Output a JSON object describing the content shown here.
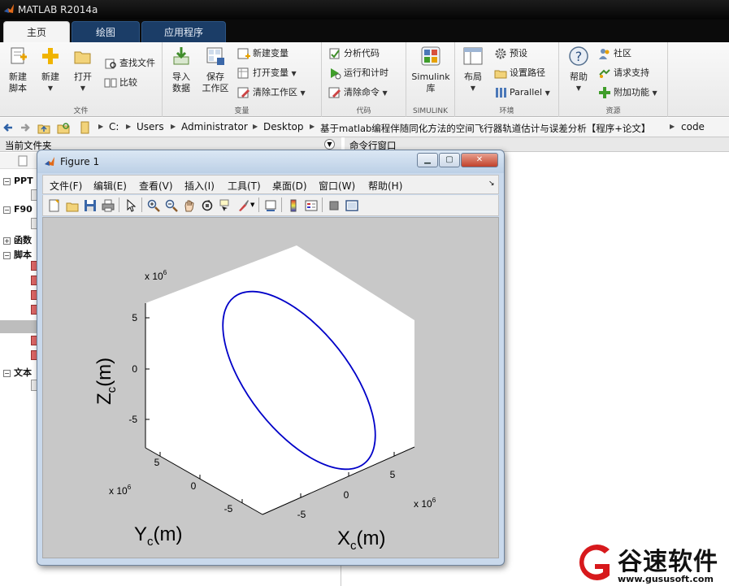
{
  "window": {
    "title": "MATLAB R2014a"
  },
  "tabs": [
    {
      "label": "主页",
      "active": true
    },
    {
      "label": "绘图",
      "active": false
    },
    {
      "label": "应用程序",
      "active": false
    }
  ],
  "toolstrip": {
    "file_group": {
      "label": "文件",
      "new_script": "新建\n脚本",
      "new": "新建",
      "open": "打开",
      "find_files": "查找文件",
      "compare": "比较"
    },
    "variable_group": {
      "label": "变量",
      "import_data": "导入\n数据",
      "save_workspace": "保存\n工作区",
      "new_variable": "新建变量",
      "open_variable": "打开变量",
      "clear_workspace": "清除工作区"
    },
    "code_group": {
      "label": "代码",
      "analyze_code": "分析代码",
      "run_and_time": "运行和计时",
      "clear_commands": "清除命令"
    },
    "simulink_group": {
      "label": "SIMULINK",
      "simulink_library": "Simulink\n库"
    },
    "environment_group": {
      "label": "环境",
      "layout": "布局",
      "preferences": "预设",
      "set_path": "设置路径",
      "parallel": "Parallel"
    },
    "resources_group": {
      "label": "资源",
      "help": "帮助",
      "community": "社区",
      "request_support": "请求支持",
      "add_ons": "附加功能"
    }
  },
  "address": {
    "crumbs": [
      "C:",
      "Users",
      "Administrator",
      "Desktop",
      "基于matlab编程伴随同化方法的空间飞行器轨道估计与误差分析【程序+论文】",
      "code"
    ]
  },
  "left_panel": {
    "title": "当前文件夹",
    "tree": [
      "PPT",
      "F90",
      "函数",
      "脚本",
      "文本"
    ]
  },
  "command_window": {
    "title": "命令行窗口"
  },
  "figure": {
    "title": "Figure 1",
    "menus": [
      "文件(F)",
      "编辑(E)",
      "查看(V)",
      "插入(I)",
      "工具(T)",
      "桌面(D)",
      "窗口(W)",
      "帮助(H)"
    ],
    "toolbar_icons": [
      "new-figure-icon",
      "open-file-icon",
      "save-icon",
      "print-icon",
      "pointer-icon",
      "zoom-in-icon",
      "zoom-out-icon",
      "pan-icon",
      "rotate-icon",
      "data-cursor-icon",
      "brush-icon",
      "link-plot-icon",
      "colorbar-icon",
      "legend-icon",
      "hide-plot-tools-icon",
      "show-plot-tools-icon"
    ],
    "plot": {
      "z_label": "Z",
      "z_sub": "c",
      "z_unit": "(m)",
      "y_label": "Y",
      "y_sub": "c",
      "y_unit": "(m)",
      "x_label": "X",
      "x_sub": "c",
      "x_unit": "(m)",
      "exp_base": "x 10",
      "exp_power": "6",
      "z_ticks": [
        "5",
        "0",
        "-5"
      ],
      "y_ticks": [
        "5",
        "0",
        "-5"
      ],
      "x_ticks": [
        "-5",
        "0",
        "5"
      ],
      "curve_color": "#0000c8"
    }
  },
  "watermark": {
    "brand": "谷速软件",
    "url": "www.gususoft.com",
    "color": "#d7191c"
  }
}
